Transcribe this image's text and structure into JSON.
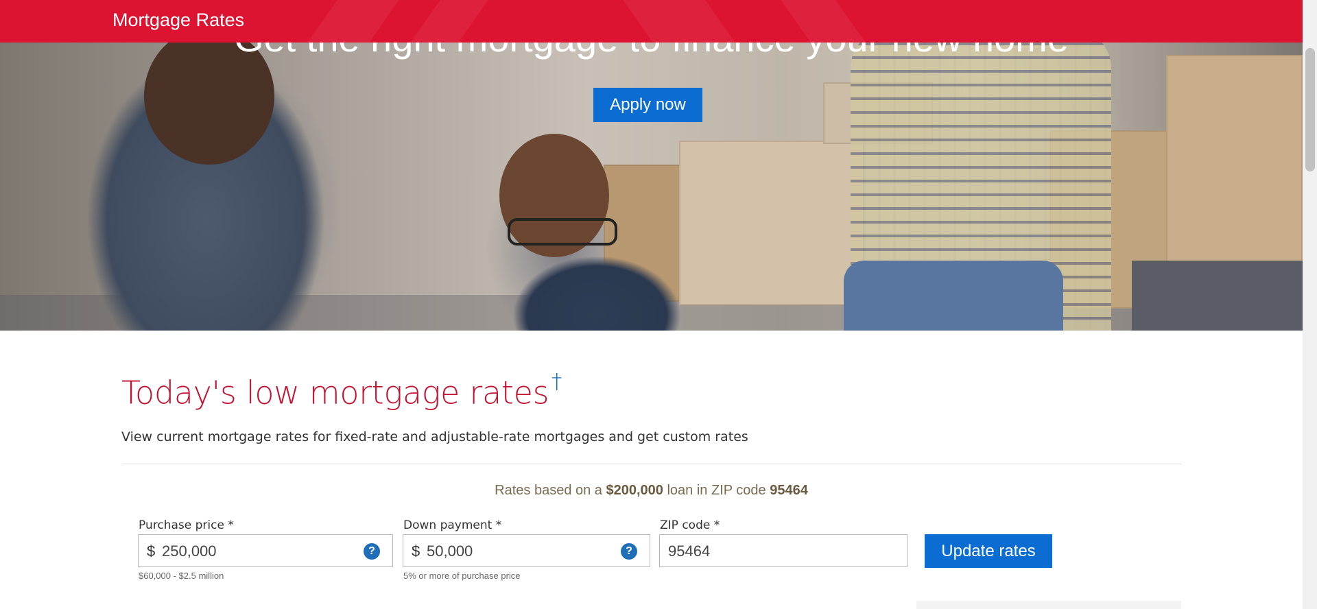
{
  "header": {
    "title": "Mortgage Rates",
    "bg_color": "#dc1431"
  },
  "hero": {
    "headline": "Get the right mortgage to finance your new home",
    "apply_label": "Apply now"
  },
  "main": {
    "title": "Today's low mortgage rates",
    "title_mark": "†",
    "subtitle": "View current mortgage rates for fixed-rate and adjustable-rate mortgages and get custom rates",
    "summary": {
      "prefix": "Rates based on a ",
      "loan": "$200,000",
      "middle": " loan in ZIP code ",
      "zip": "95464"
    },
    "form": {
      "purchase_price": {
        "label": "Purchase price *",
        "currency": "$",
        "value": "250,000",
        "hint": "$60,000 - $2.5 million",
        "help_icon": "?"
      },
      "down_payment": {
        "label": "Down payment *",
        "currency": "$",
        "value": "50,000",
        "hint": "5% or more of purchase price",
        "help_icon": "?"
      },
      "zip_code": {
        "label": "ZIP code *",
        "value": "95464"
      },
      "update_label": "Update rates"
    }
  },
  "colors": {
    "accent_blue": "#0b6dd1",
    "title_red": "#c41230"
  }
}
